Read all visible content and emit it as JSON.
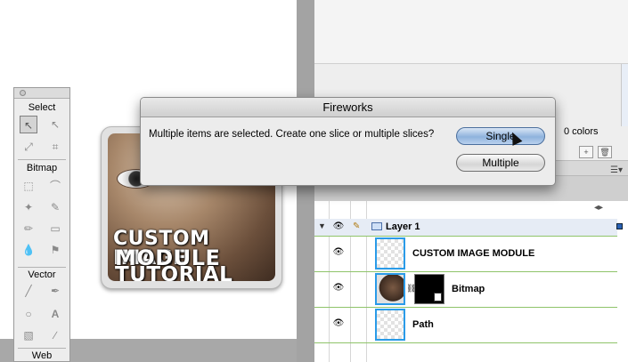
{
  "dialog": {
    "title": "Fireworks",
    "message": "Multiple items are selected. Create one slice or multiple slices?",
    "buttons": {
      "single": "Single",
      "multiple": "Multiple"
    }
  },
  "tools": {
    "sections": {
      "select": "Select",
      "bitmap": "Bitmap",
      "vector": "Vector",
      "web": "Web"
    }
  },
  "artwork": {
    "lines": [
      "CUSTOM IMAGE",
      "MODULE",
      "TUTORIAL"
    ]
  },
  "panel": {
    "colors_count": "0 colors"
  },
  "layers": {
    "layer_name": "Layer 1",
    "objects": [
      {
        "label": "CUSTOM IMAGE MODULE"
      },
      {
        "label": "Bitmap"
      },
      {
        "label": "Path"
      }
    ]
  }
}
